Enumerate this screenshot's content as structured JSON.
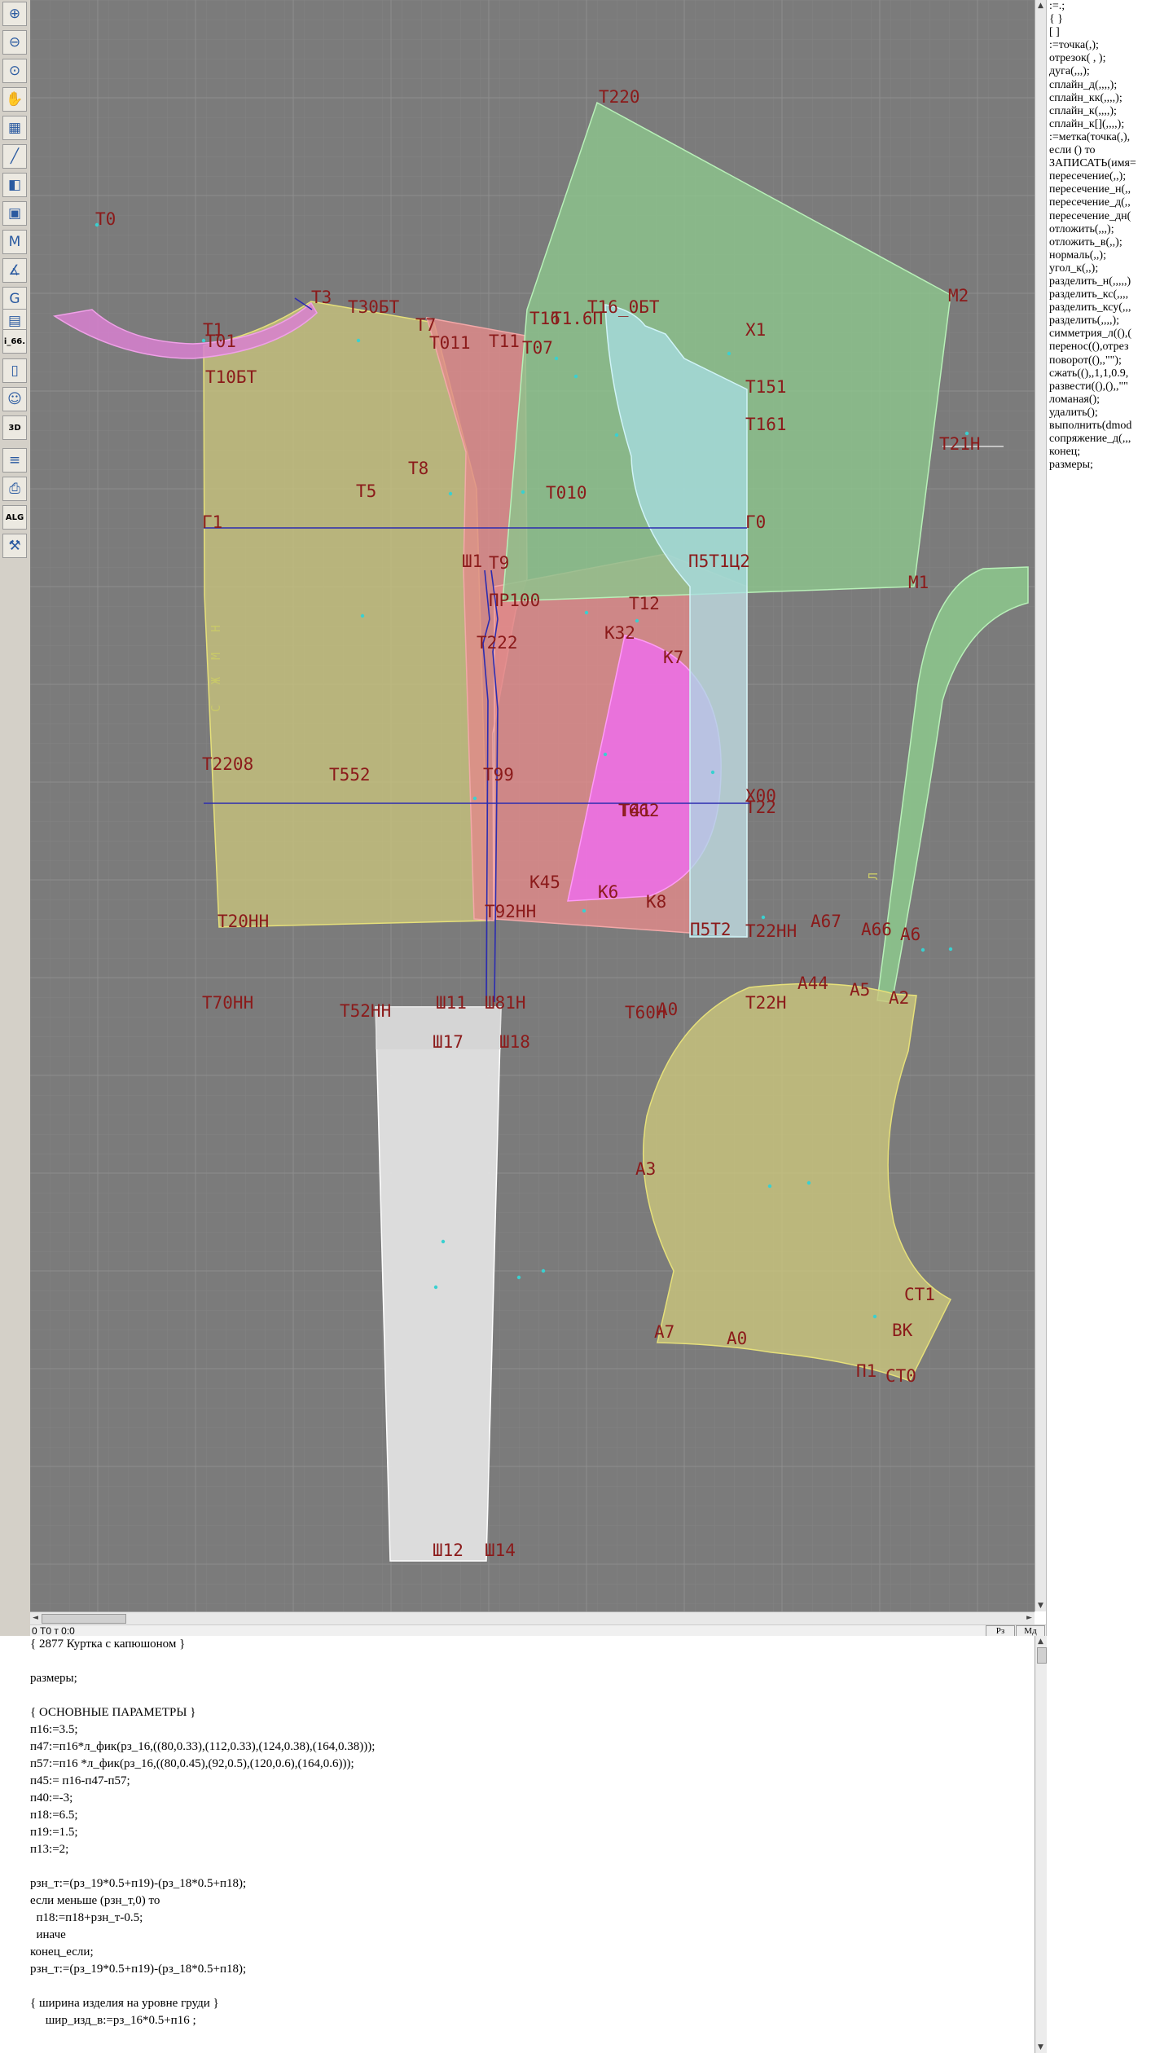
{
  "toolbar": {
    "buttons": [
      {
        "icon": "zoom-in-icon",
        "glyph": "⊕"
      },
      {
        "icon": "zoom-out-icon",
        "glyph": "⊖"
      },
      {
        "icon": "zoom-window-icon",
        "glyph": "⊙"
      },
      {
        "icon": "pan-icon",
        "glyph": "✋"
      },
      {
        "icon": "grid-icon",
        "glyph": "▦"
      },
      {
        "icon": "line-tool-icon",
        "glyph": "╱"
      },
      {
        "icon": "pattern-piece-icon",
        "glyph": "◧"
      },
      {
        "icon": "layers-icon",
        "glyph": "▣"
      },
      {
        "icon": "model-icon",
        "glyph": "M"
      },
      {
        "icon": "measure-icon",
        "glyph": "∡"
      },
      {
        "icon": "grading-icon",
        "glyph": "G"
      },
      {
        "icon": "cards-icon",
        "glyph": "▤"
      },
      {
        "icon": "text-button",
        "glyph": "i_66."
      },
      {
        "icon": "document-icon",
        "glyph": "▯"
      },
      {
        "icon": "avatar-icon",
        "glyph": "☺"
      },
      {
        "icon": "3d-view-icon",
        "glyph": "3D"
      },
      {
        "icon": "list-icon",
        "glyph": "≡"
      },
      {
        "icon": "print-icon",
        "glyph": "⎙"
      },
      {
        "icon": "algorithm-icon",
        "glyph": "ALG"
      },
      {
        "icon": "tool-icon",
        "glyph": "⚒"
      }
    ]
  },
  "colors": {
    "canvas_bg": "#7b7b7b",
    "grid": "#8a8a8a",
    "yellow_piece": "#c9c47c",
    "pink_piece": "#e08a8a",
    "magenta_piece": "#e070d8",
    "green_piece": "#8cc48c",
    "cyan_piece": "#a8dde4",
    "white_piece": "#e4e4e4",
    "label": "#8b1a1a",
    "construction_line": "#2c2cb0"
  },
  "labels": [
    "Т220",
    "Т0",
    "Т3",
    "Т30БТ",
    "Т7",
    "Т1",
    "Т01",
    "Т10БТ",
    "Т011",
    "Т11",
    "Т07",
    "Т16",
    "Т16_0БТ",
    "Т1.6П",
    "Х1",
    "М2",
    "Т151",
    "Т161",
    "Т21Н",
    "Т8",
    "Т5",
    "Т010",
    "Г1",
    "Г0",
    "Ш1",
    "Т9",
    "П5Т1Ц2",
    "М1",
    "ПР100",
    "Т12",
    "Т222",
    "К32",
    "К7",
    "Т2208",
    "Т552",
    "Т99",
    "Т662",
    "Х00",
    "Т22",
    "Т41",
    "К45",
    "К6",
    "К8",
    "Т20НН",
    "Т92НН",
    "П5Т2",
    "Т22НН",
    "А67",
    "А66",
    "А6",
    "А44",
    "А5",
    "А2",
    "Т70НН",
    "Т52НН",
    "Ш11",
    "Ш81Н",
    "Т60Н",
    "А0",
    "Т22Н",
    "Ш17",
    "Ш18",
    "А3",
    "СТ1",
    "А7",
    "А0",
    "ВК",
    "П1",
    "СТ0",
    "Ш12",
    "Ш14",
    "Н",
    "М",
    "Ж",
    "С",
    "Л",
    "А"
  ],
  "command_panel": {
    "items": [
      ":=.;",
      "  {  }",
      "  [  ]",
      ":=точка(,);",
      "отрезок( , );",
      "дуга(,,,);",
      "сплайн_д(,,,,);",
      "сплайн_кк(,,,,);",
      "сплайн_к(,,,,);",
      "сплайн_к[](,,,,);",
      ":=метка(точка(,),",
      "если () то",
      "ЗАПИСАТЬ(имя=",
      "пересечение(,,);",
      "пересечение_н(,,",
      "пересечение_д(,,",
      "пересечение_дн(",
      "отложить(,,,);",
      "отложить_в(,,);",
      "нормаль(,,);",
      "угол_к(,,);",
      "разделить_н(,,,,,)",
      "разделить_кс(,,,,",
      "разделить_ксу(,,,",
      "разделить(,,,,);",
      "симметрия_л((),(",
      "перенос((),отрез",
      "поворот((),,\"\");",
      "сжать((),,1,1,0.9,",
      "развести((),(),,\"\"",
      "ломаная();",
      "удалить();",
      "выполнить(dmod",
      "сопряжение_д(,,,",
      "конец;",
      "размеры;"
    ]
  },
  "status_bar": {
    "text": "0  Т0 т 0:0",
    "btn_pz": "Рз",
    "btn_md": "Мд"
  },
  "editor": {
    "lines": [
      "{ 2877 Куртка с капюшоном }",
      "",
      "размеры;",
      "",
      "{ ОСНОВНЫЕ ПАРАМЕТРЫ }",
      "п16:=3.5;",
      "п47:=п16*л_фик(рз_16,((80,0.33),(112,0.33),(124,0.38),(164,0.38)));",
      "п57:=п16 *л_фик(рз_16,((80,0.45),(92,0.5),(120,0.6),(164,0.6)));",
      "п45:= п16-п47-п57;",
      "п40:=-3;",
      "п18:=6.5;",
      "п19:=1.5;",
      "п13:=2;",
      "",
      "рзн_т:=(рз_19*0.5+п19)-(рз_18*0.5+п18);",
      "если меньше (рзн_т,0) то",
      "  п18:=п18+рзн_т-0.5;",
      "  иначе",
      "конец_если;",
      "рзн_т:=(рз_19*0.5+п19)-(рз_18*0.5+п18);",
      "",
      "{ ширина изделия на уровне груди }",
      "     шир_изд_в:=рз_16*0.5+п16 ;"
    ]
  }
}
